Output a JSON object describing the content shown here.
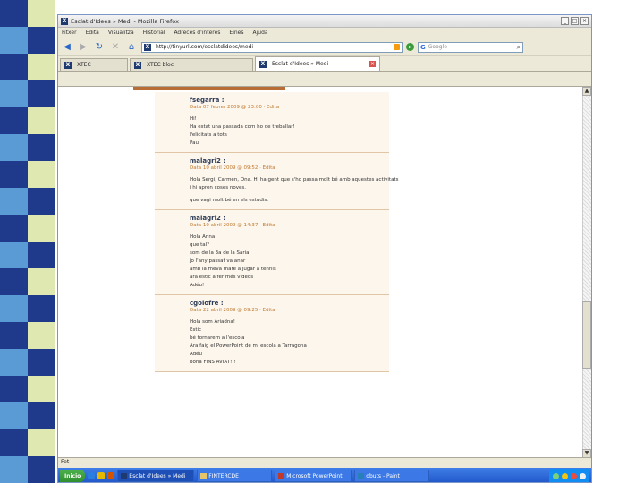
{
  "browser": {
    "title": "Esclat d'Idees » Medi - Mozilla Firefox",
    "menu": [
      "Fitxer",
      "Edita",
      "Visualitza",
      "Historial",
      "Adreces d'interès",
      "Eines",
      "Ajuda"
    ],
    "url": "http://tinyurl.com/esclatdidees/medi",
    "search_placeholder": "Google",
    "tabs": [
      "XTEC",
      "XTEC bloc",
      "Esclat d'Idees » Medi"
    ],
    "status": "Fet"
  },
  "comments": [
    {
      "author": "fsegarra :",
      "meta": "Data 07 febrer 2009 @ 23:00 · Edita",
      "lines": [
        "Hi!",
        "Ha estat una passada com ho de treballar!",
        "Felicitats a tots",
        "Pau"
      ]
    },
    {
      "author": "malagri2 :",
      "meta": "Data 10 abril 2009 @ 09:52 · Edita",
      "lines": [
        "Hola Sergi, Carmen, Ona. Hi ha gent que s'ho passa molt bé amb aquestes activitats",
        "i hi aprèn coses noves.",
        "",
        "que vagi molt bé en els estudis."
      ]
    },
    {
      "author": "malagri2 :",
      "meta": "Data 10 abril 2009 @ 14:37 · Edita",
      "lines": [
        "Hola Anna",
        "que tal?",
        "som de la 3a de la Saria,",
        "jo l'any passat va anar",
        "amb la meva mare a jugar a tennis",
        "ara estic a fer més vídeos",
        "Adéu!"
      ]
    },
    {
      "author": "cgolofre :",
      "meta": "Data 22 abril 2009 @ 09:25 · Edita",
      "lines": [
        "Hola som Ariadna!",
        "Estic",
        "bé tornarem a l'escola",
        "Ara faig el PowerPoint de mi escola a Tarragona",
        "Adéu",
        "bona FINS AVIAT!!!"
      ]
    }
  ],
  "taskbar": {
    "start_label": "Inicio",
    "tasks": [
      "Esclat d'Idees » Medi",
      "FINTERCDE",
      "Microsoft PowerPoint",
      "obuts - Paint"
    ]
  },
  "colors": {
    "banner": "#b86d36",
    "comment_bg": "#fdf6ed",
    "meta": "#c0782c"
  }
}
